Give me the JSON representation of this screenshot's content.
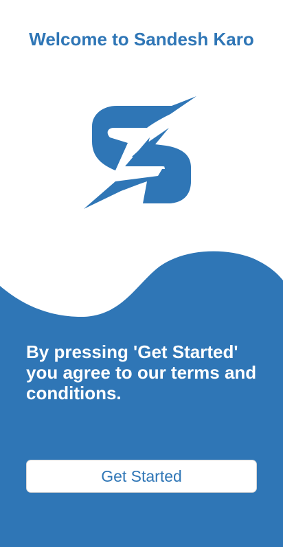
{
  "header": {
    "title": "Welcome to Sandesh Karo"
  },
  "logo": {
    "icon": "s-lightning-logo-icon",
    "color": "#2f76b6"
  },
  "theme": {
    "accent": "#2f76b6",
    "background": "#ffffff"
  },
  "terms": {
    "text": "By pressing 'Get Started' you agree to our terms and conditions."
  },
  "actions": {
    "get_started_label": "Get Started"
  }
}
